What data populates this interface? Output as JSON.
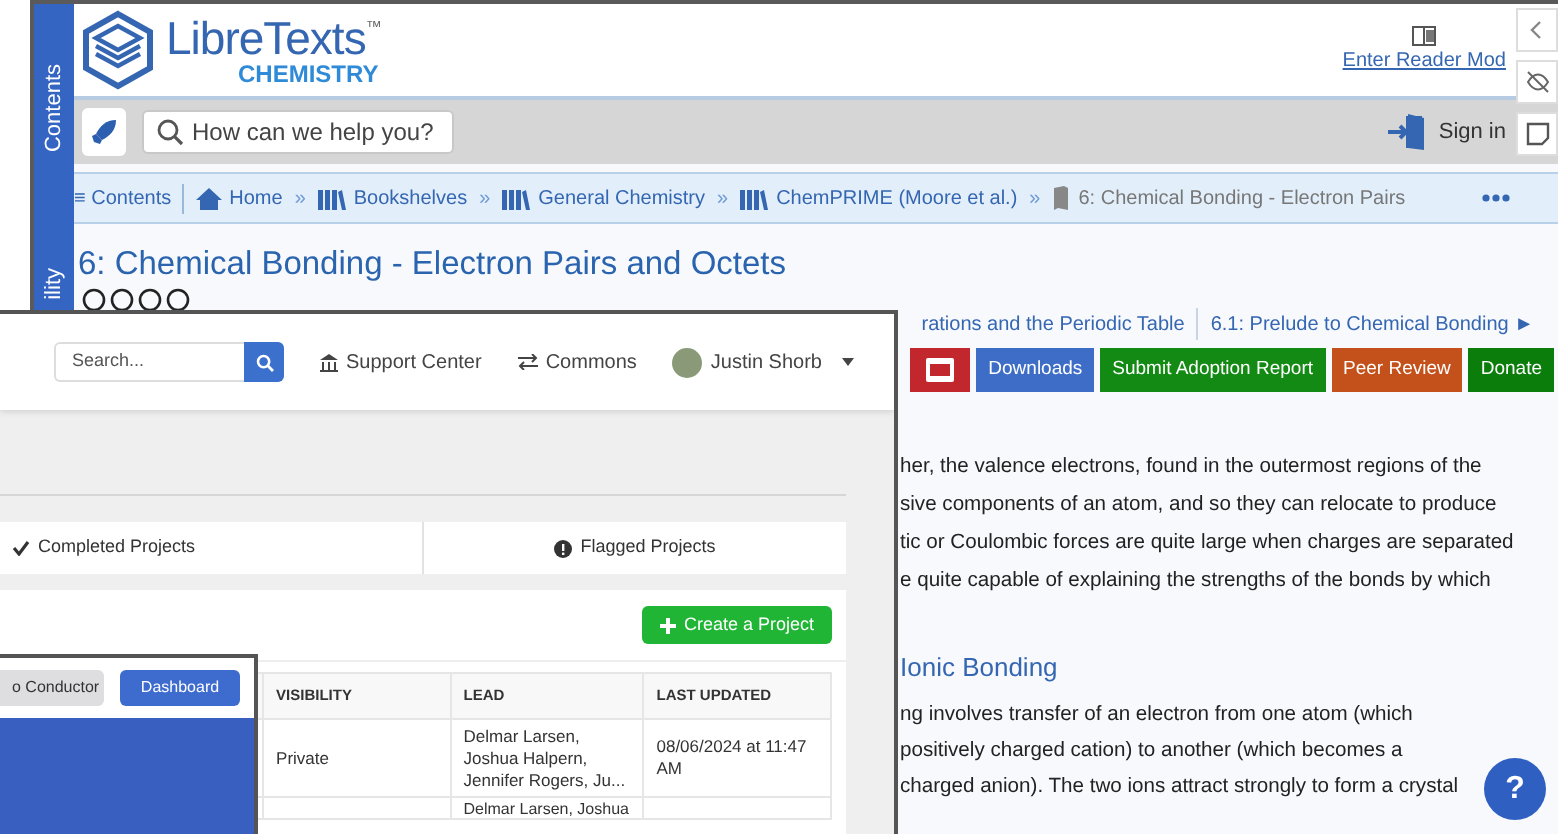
{
  "reader_window": {
    "sidebar_tabs": [
      "Contents",
      "ility"
    ],
    "logo": {
      "name": "LibreTexts",
      "mark": "™",
      "subtitle": "CHEMISTRY"
    },
    "reader_mode": "Enter Reader Mod",
    "search": {
      "placeholder": "How can we help you?"
    },
    "sign_in": "Sign in",
    "breadcrumbs": [
      {
        "kind": "contents",
        "label": "≡ Contents"
      },
      {
        "kind": "home",
        "label": "Home"
      },
      {
        "kind": "separator",
        "label": "»"
      },
      {
        "kind": "shelf",
        "label": "Bookshelves"
      },
      {
        "kind": "separator",
        "label": "»"
      },
      {
        "kind": "shelf",
        "label": "General Chemistry"
      },
      {
        "kind": "separator",
        "label": "»"
      },
      {
        "kind": "shelf",
        "label": "ChemPRIME (Moore et al.)"
      },
      {
        "kind": "separator",
        "label": "»"
      },
      {
        "kind": "page",
        "label": "6: Chemical Bonding - Electron Pairs"
      }
    ],
    "title": "6: Chemical Bonding - Electron Pairs and Octets",
    "nav": {
      "previous": "rations and the Periodic Table",
      "next": "6.1: Prelude to Chemical Bonding ►"
    },
    "action_buttons": [
      {
        "kind": "pdf",
        "color": "#c1272d"
      },
      {
        "kind": "text",
        "label": "Downloads",
        "color": "#3d6dc7"
      },
      {
        "kind": "text",
        "label": "Submit Adoption Report",
        "color": "#138a13"
      },
      {
        "kind": "text",
        "label": "Peer Review",
        "color": "#c4511b"
      },
      {
        "kind": "text",
        "label": "Donate",
        "color": "#0b7d0b"
      }
    ],
    "sections": [
      {
        "kind": "paragraph",
        "lines": [
          "her, the valence electrons, found in the outermost regions of the",
          "sive components of an atom, and so they can relocate to produce",
          "tic or Coulombic forces are quite large when charges are separated",
          "e quite capable of explaining the strengths of the bonds by which"
        ]
      },
      {
        "kind": "heading",
        "text": "Ionic Bonding"
      },
      {
        "kind": "paragraph",
        "lines": [
          "ng involves transfer of an electron from one atom (which",
          "positively charged cation) to another (which becomes a",
          "charged anion). The two ions attract strongly to form a crystal"
        ]
      }
    ],
    "help_button": "?"
  },
  "projects_window": {
    "search": {
      "placeholder": "Search..."
    },
    "nav_links": [
      {
        "kind": "support",
        "label": "Support Center"
      },
      {
        "kind": "commons",
        "label": "Commons"
      }
    ],
    "user": "Justin Shorb",
    "tabs": [
      {
        "label": "Completed Projects",
        "kind": "check",
        "selected": false
      },
      {
        "label": "Flagged Projects",
        "kind": "alert",
        "selected": false
      }
    ],
    "create_button": "Create a Project",
    "table": {
      "columns": [
        "VISIBILITY",
        "LEAD",
        "LAST UPDATED"
      ],
      "rows": [
        {
          "visibility": "Private",
          "lead": "Delmar Larsen, Joshua Halpern, Jennifer Rogers, Ju...",
          "last_updated": "08/06/2024 at 11:47 AM"
        },
        {
          "lead": "Delmar Larsen, Joshua"
        }
      ]
    }
  },
  "conductor_window": {
    "buttons": [
      {
        "label": "o Conductor",
        "kind": "secondary"
      },
      {
        "label": "Dashboard",
        "kind": "primary"
      }
    ]
  }
}
